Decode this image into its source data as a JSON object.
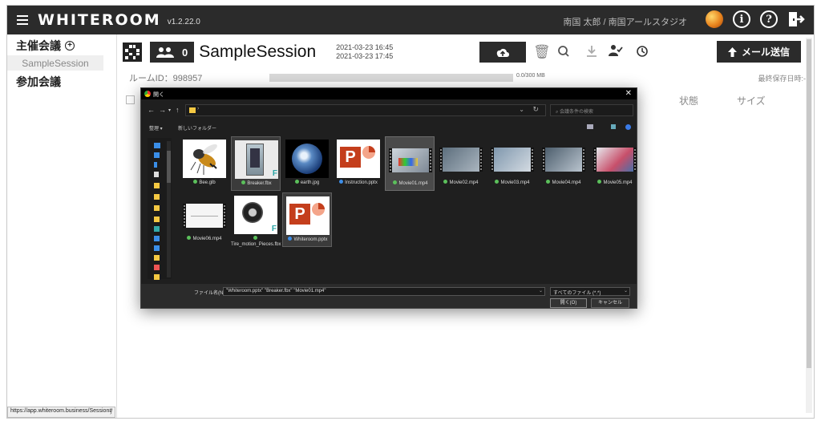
{
  "app": {
    "logo": "WHITEROOM",
    "version": "v1.2.22.0",
    "user": "南国 太郎 / 南国アールスタジオ"
  },
  "topbar": {
    "icons": [
      "avatar-icon",
      "info-icon",
      "help-icon",
      "logout-icon"
    ],
    "info_glyph": "i",
    "help_glyph": "?"
  },
  "sidebar": {
    "host_label": "主催会議",
    "host_items": [
      "SampleSession"
    ],
    "join_label": "参加会議",
    "status_url": "https://app.whiteroom.business/Session#"
  },
  "session": {
    "member_count": "0",
    "title": "SampleSession",
    "start": "2021-03-23 16:45",
    "end": "2021-03-23 17:45",
    "mail_button": "メール送信"
  },
  "room": {
    "id_label": "ルームID：998957",
    "storage": "0.0/300 MB",
    "storage_fraction": 0.0,
    "last_saved": "最終保存日時:-"
  },
  "table": {
    "col_state": "状態",
    "col_size": "サイズ"
  },
  "dialog": {
    "title": "開く",
    "search_placeholder": "会議条件の検索",
    "organize": "整理 ▾",
    "new_folder": "新しいフォルダー",
    "filename_label": "ファイル名(N):",
    "filename_value": "\"Whiteroom.pptx\" \"Breaker.fbx\" \"Movie01.mp4\"",
    "filetype": "すべてのファイル (*.*)",
    "open_button": "開く(O)",
    "cancel_button": "キャンセル",
    "files": [
      {
        "name": "Bee.glb",
        "kind": "image-bee"
      },
      {
        "name": "Breaker.fbx",
        "kind": "fbx",
        "selected": true
      },
      {
        "name": "earth.jpg",
        "kind": "earth"
      },
      {
        "name": "Instruction.pptx",
        "kind": "pptx"
      },
      {
        "name": "Movie01.mp4",
        "kind": "video",
        "selected": true
      },
      {
        "name": "Movie02.mp4",
        "kind": "video"
      },
      {
        "name": "Movie03.mp4",
        "kind": "video"
      },
      {
        "name": "Movie04.mp4",
        "kind": "video"
      },
      {
        "name": "Movie05.mp4",
        "kind": "video"
      },
      {
        "name": "Movie06.mp4",
        "kind": "video-white"
      },
      {
        "name": "Tire_motion_Pieces.fbx",
        "kind": "tire"
      },
      {
        "name": "Whiteroom.pptx",
        "kind": "pptx",
        "selected": true
      }
    ]
  }
}
